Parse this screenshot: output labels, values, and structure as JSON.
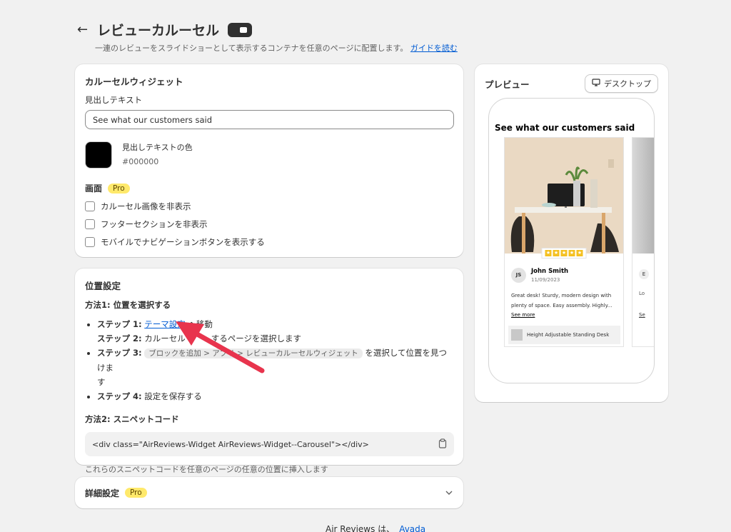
{
  "header": {
    "title": "レビューカルーセル",
    "subtitle": "一連のレビューをスライドショーとして表示するコンテナを任意のページに配置します。",
    "guide_link": "ガイドを読む"
  },
  "widget_card": {
    "title": "カルーセルウィジェット",
    "heading_label": "見出しテキスト",
    "heading_value": "See what our customers said",
    "color_label": "見出しテキストの色",
    "color_value": "#000000",
    "display_title": "画面",
    "pro_badge": "Pro",
    "options": [
      "カルーセル画像を非表示",
      "フッターセクションを非表示",
      "モバイルでナビゲーションボタンを表示する"
    ]
  },
  "position_card": {
    "title": "位置設定",
    "method1": "方法1: 位置を選択する",
    "step1_label": "ステップ 1",
    "step1_link": "テーマ設定",
    "step1_suffix": "へ移動",
    "step2_label": "ステップ 2",
    "step2_text": "カルーセル",
    "step2_text_end": "するページを選択します",
    "step3_label": "ステップ 3",
    "step3_chip": "ブロックを追加 > アプリ > レビューカルーセルウィジェット",
    "step3_text": "を選択して位置を見つけま",
    "step3_text_end": "す",
    "step4_label": "ステップ 4",
    "step4_text": "設定を保存する",
    "method2": "方法2: スニペットコード",
    "snippet": "<div class=\"AirReviews-Widget AirReviews-Widget--Carousel\"></div>",
    "helper": "これらのスニペットコードを任意のページの任意の位置に挿入します"
  },
  "advanced_card": {
    "title": "詳細設定",
    "pro_badge": "Pro"
  },
  "preview_card": {
    "title": "プレビュー",
    "device_label": "デスクトップ",
    "phone_heading": "See what our customers said",
    "review": {
      "initials": "JS",
      "name": "John Smith",
      "date": "11/09/2023",
      "text": "Great desk! Sturdy, modern design with plenty of space. Easy assembly. Highly...",
      "more": "See more",
      "product": "Height Adjustable Standing Desk",
      "rating": 5
    },
    "partial_review": {
      "initial": "E",
      "snippet": "Lo",
      "more": "Se"
    }
  },
  "footer": {
    "text": "Air Reviews は、",
    "link": "Avada"
  },
  "colors": {
    "accent_link": "#005bd3",
    "pro_badge_bg": "#ffe96b",
    "arrow": "#e8344d"
  }
}
